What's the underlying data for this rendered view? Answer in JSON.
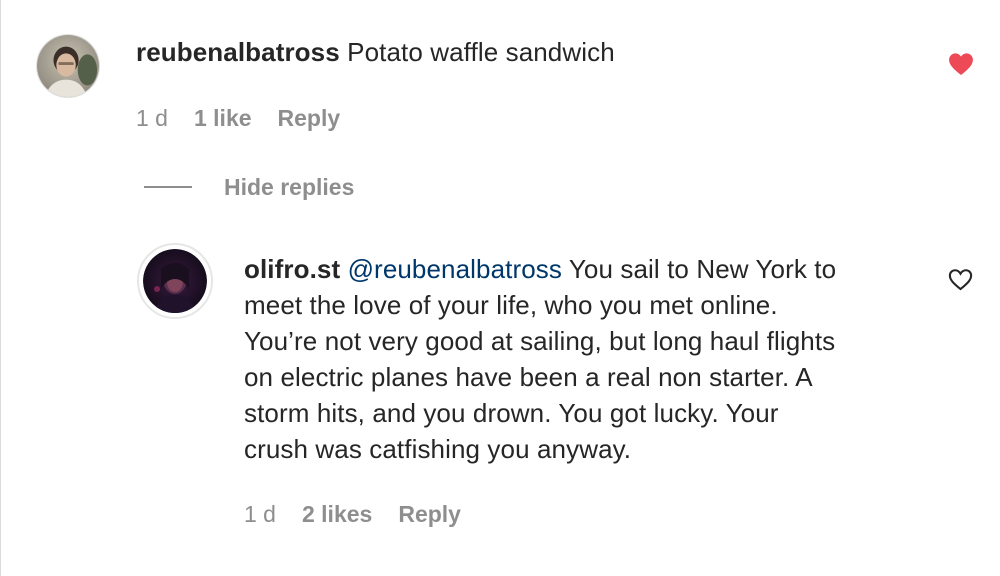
{
  "comment": {
    "username": "reubenalbatross",
    "text": "Potato waffle sandwich",
    "time": "1 d",
    "likes": "1 like",
    "reply_label": "Reply",
    "liked": true
  },
  "replies_toggle": {
    "label": "Hide replies"
  },
  "reply": {
    "username": "olifro.st",
    "mention": "@reubenalbatross",
    "lines": [
      "You sail to New York to",
      "meet the love of your life, who you met online.",
      "You’re not very good at sailing, but long haul flights",
      "on electric planes have been a real non starter. A",
      "storm hits, and you drown. You got lucky. Your",
      "crush was catfishing you anyway."
    ],
    "time": "1 d",
    "likes": "2 likes",
    "reply_label": "Reply",
    "liked": false
  },
  "colors": {
    "heart_liked": "#ed4956",
    "text": "#262626",
    "secondary": "#8e8e8e",
    "mention": "#00376b"
  },
  "icons": {
    "liked_heart": "heart-filled-icon",
    "unliked_heart": "heart-outline-icon"
  }
}
